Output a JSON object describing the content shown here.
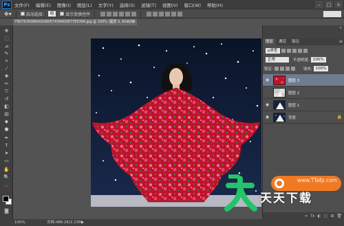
{
  "app": {
    "logo": "Ps"
  },
  "menu": [
    "文件(F)",
    "编辑(E)",
    "图像(I)",
    "图层(L)",
    "文字(Y)",
    "选择(S)",
    "滤镜(T)",
    "视图(V)",
    "窗口(W)",
    "帮助(H)"
  ],
  "window_controls": [
    "–",
    "□",
    "×"
  ],
  "options": {
    "auto_select_label": "自动选择：",
    "auto_select_value": "组",
    "show_transform_label": "显示变换控件"
  },
  "document": {
    "tab_title": "F807635086401080574364D0E77E0394.jpg @ 100% (图层 3, RGB/8)",
    "close": "×",
    "zoom": "100%",
    "doc_info": "文档:486.2K/2.23M"
  },
  "layers_panel": {
    "tabs": [
      "图层",
      "通道",
      "路径"
    ],
    "menu_icon": "≡",
    "kind_label": "p类型",
    "blend_mode": "正常",
    "opacity_label": "不透明度:",
    "opacity_value": "100%",
    "lock_label": "锁定:",
    "fill_label": "填充:",
    "fill_value": "100%",
    "layers": [
      {
        "name": "图层 3",
        "selected": true,
        "visible": true
      },
      {
        "name": "图层 2",
        "selected": false,
        "visible": false
      },
      {
        "name": "图层 1",
        "selected": false,
        "visible": true
      },
      {
        "name": "背景",
        "selected": false,
        "visible": true,
        "locked": true
      }
    ],
    "bottom_icons": [
      "∞",
      "fx",
      "◐",
      "▢",
      "⊞",
      "🗑"
    ]
  },
  "watermark": {
    "url": "www.TTafp.com",
    "text": "天天下载"
  },
  "colors": {
    "accent": "#6d7c91",
    "fabric": "#c0122a",
    "watermark_green": "#23c36a",
    "watermark_orange": "#f07a24"
  }
}
